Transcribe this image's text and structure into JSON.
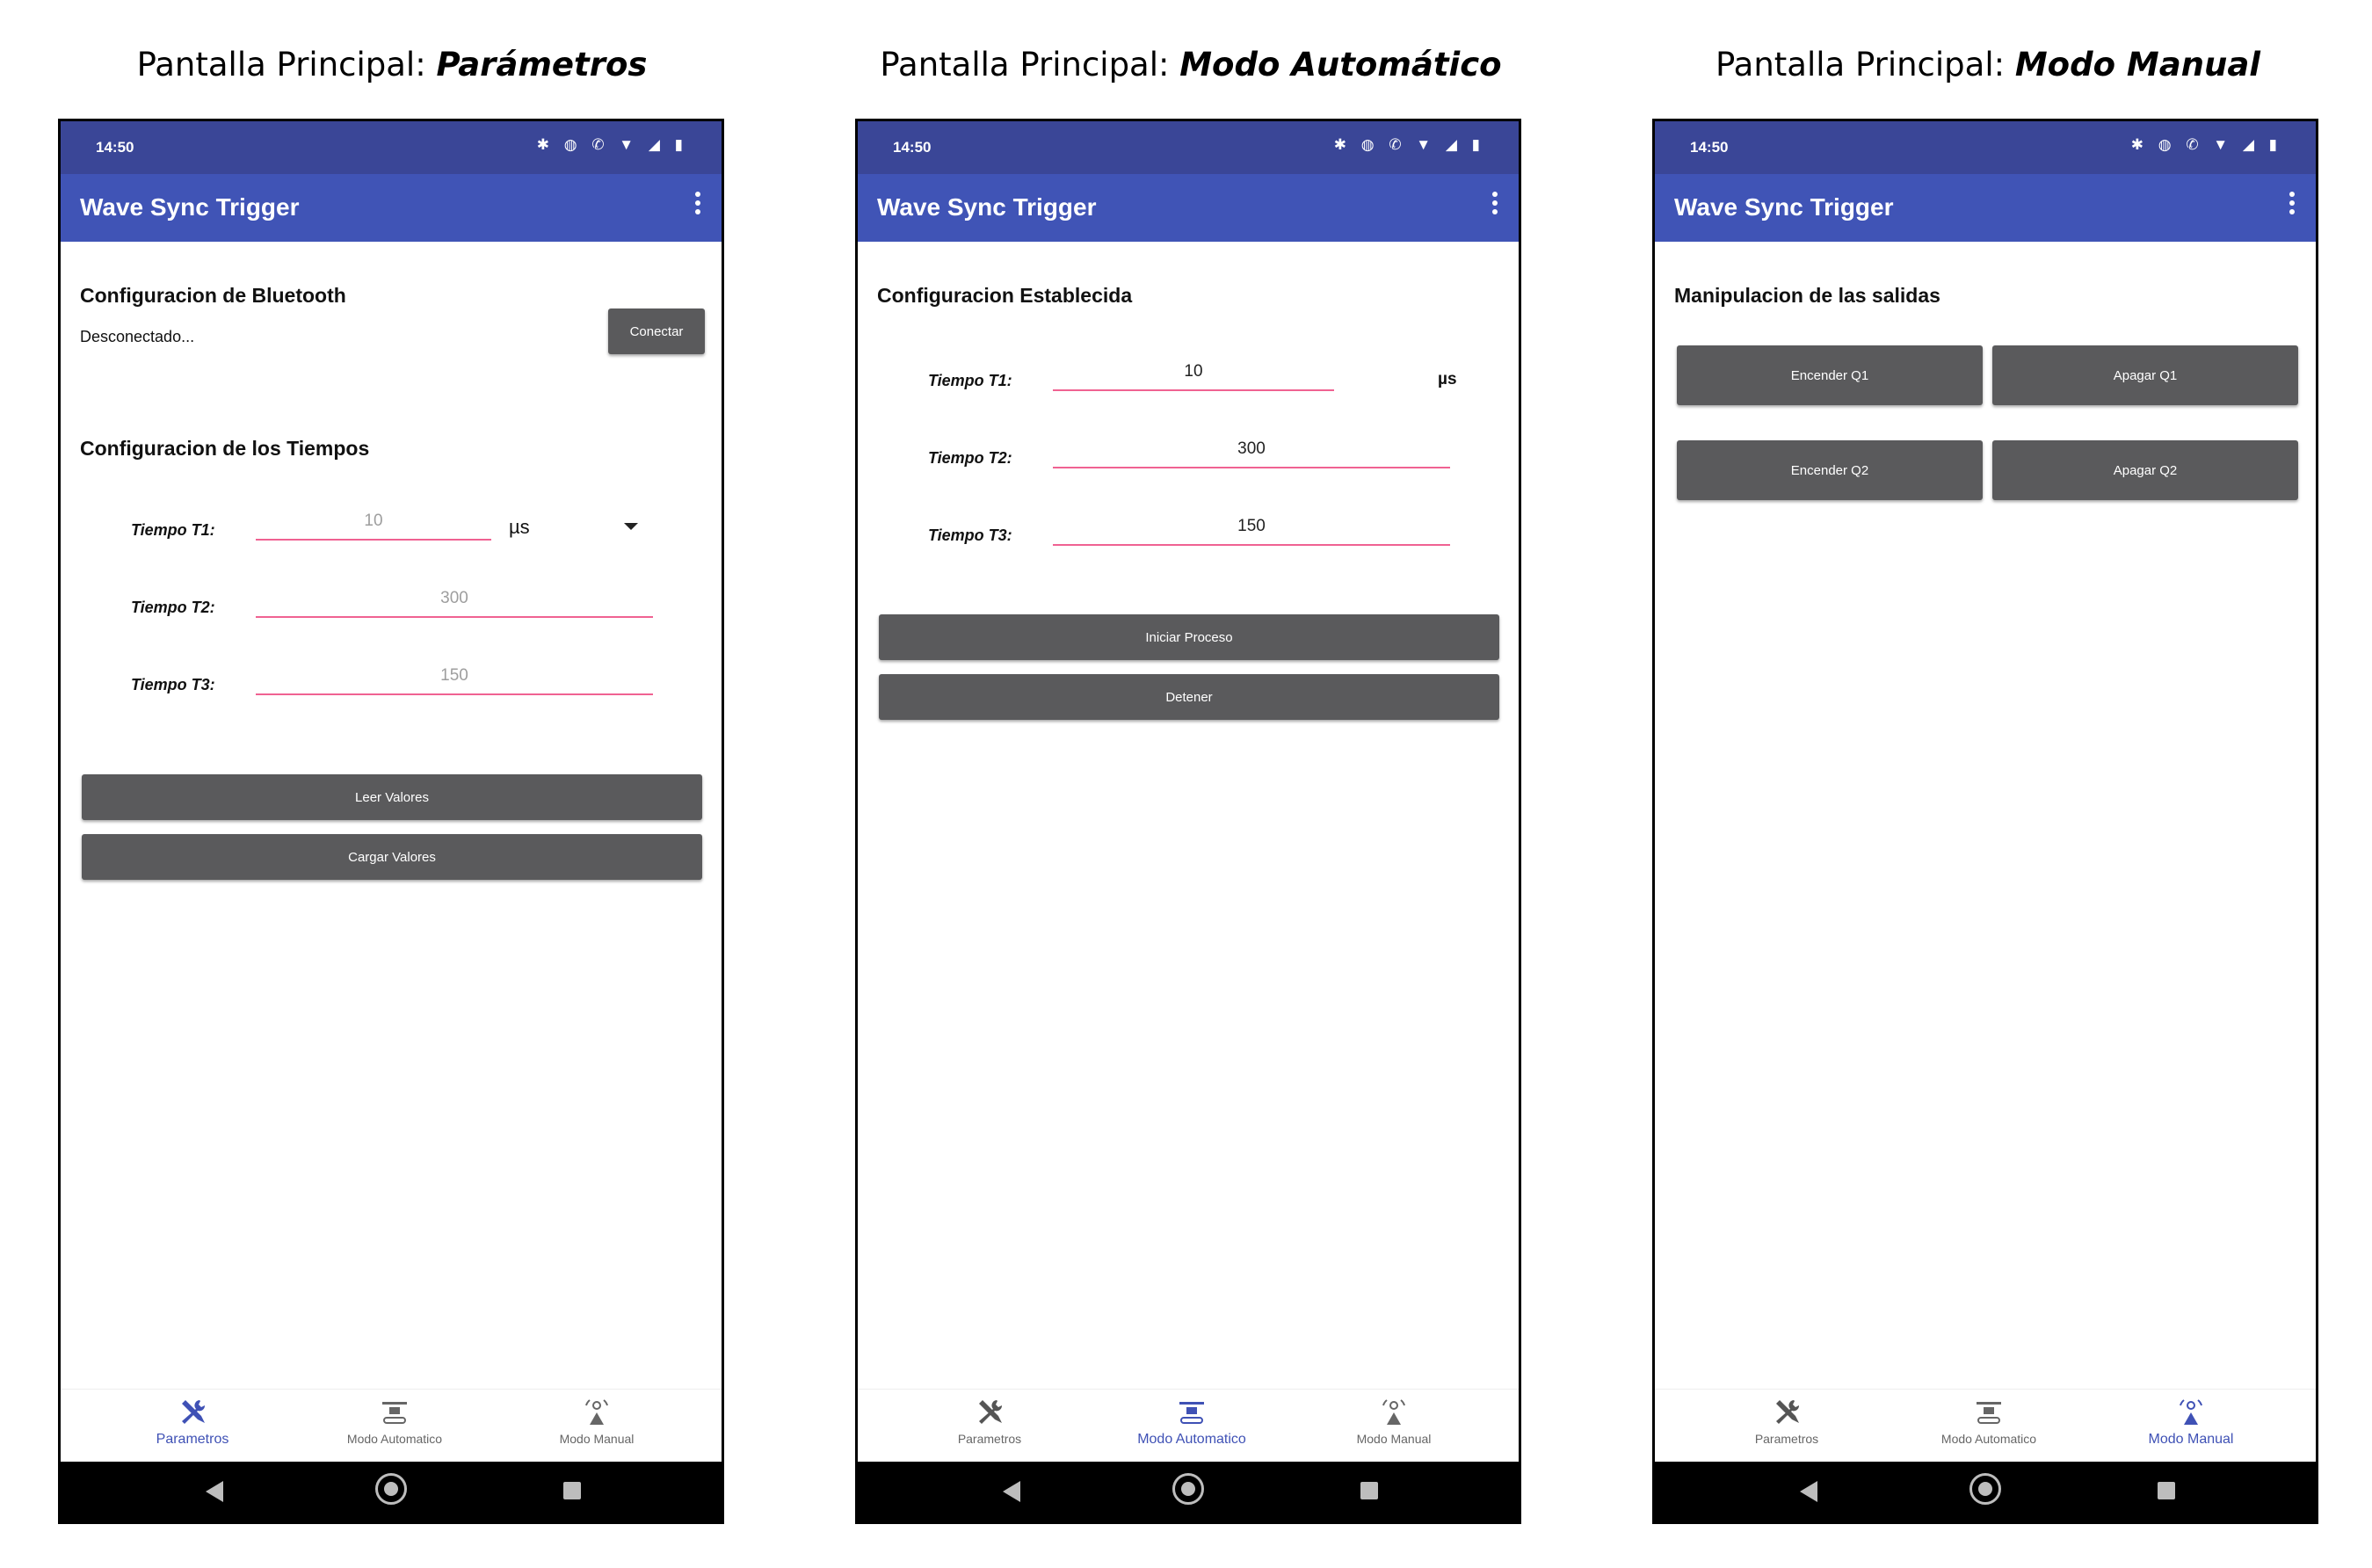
{
  "captions": [
    {
      "prefix": "Pantalla Principal: ",
      "emph": "Parámetros"
    },
    {
      "prefix": "Pantalla Principal: ",
      "emph": "Modo Automático"
    },
    {
      "prefix": "Pantalla Principal: ",
      "emph": "Modo Manual"
    }
  ],
  "status": {
    "time": "14:50",
    "icons": "✱ ◍ ✆ ▼ ◢ ▮"
  },
  "app": {
    "title": "Wave Sync Trigger"
  },
  "screen1": {
    "bt_heading": "Configuracion de Bluetooth",
    "bt_status": "Desconectado...",
    "connect_button": "Conectar",
    "times_heading": "Configuracion de los Tiempos",
    "t1_label": "Tiempo T1:",
    "t1_hint": "10",
    "unit_select": "µs",
    "t2_label": "Tiempo T2:",
    "t2_hint": "300",
    "t3_label": "Tiempo T3:",
    "t3_hint": "150",
    "read_button": "Leer Valores",
    "load_button": "Cargar Valores"
  },
  "screen2": {
    "heading": "Configuracion Establecida",
    "t1_label": "Tiempo T1:",
    "t1_value": "10",
    "unit": "µs",
    "t2_label": "Tiempo T2:",
    "t2_value": "300",
    "t3_label": "Tiempo T3:",
    "t3_value": "150",
    "start_button": "Iniciar Proceso",
    "stop_button": "Detener"
  },
  "screen3": {
    "heading": "Manipulacion de las salidas",
    "on_q1": "Encender Q1",
    "off_q1": "Apagar Q1",
    "on_q2": "Encender Q2",
    "off_q2": "Apagar Q2"
  },
  "nav": {
    "parametros": "Parametros",
    "automatico": "Modo Automatico",
    "manual": "Modo Manual"
  },
  "colors": {
    "statusbar": "#3a4697",
    "appbar": "#4054b6",
    "accent": "#3f51b5",
    "underline": "#f06292",
    "button": "#5a5a5c"
  }
}
